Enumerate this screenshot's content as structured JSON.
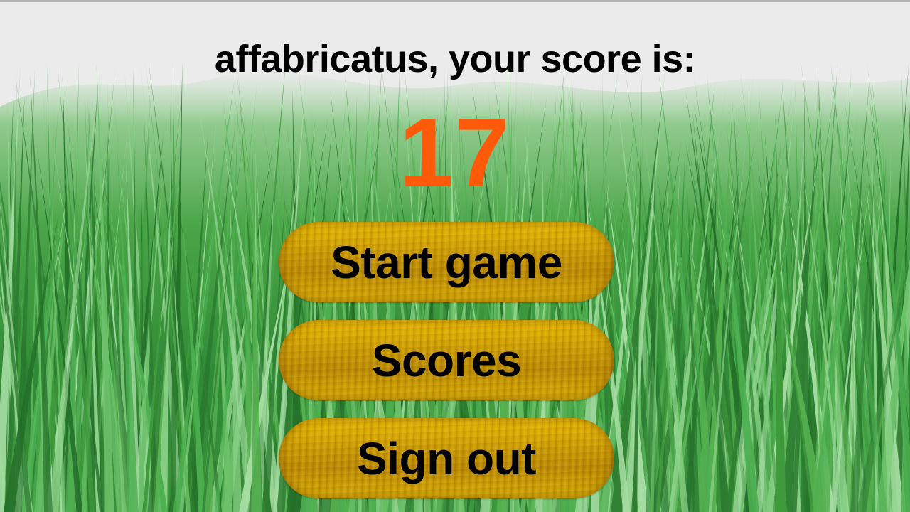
{
  "screen": {
    "player_name": "affabricatus",
    "headline": "affabricatus, your score is:",
    "score": "17",
    "background": "grass-field-image"
  },
  "menu": {
    "start_label": "Start game",
    "scores_label": "Scores",
    "signout_label": "Sign out"
  },
  "colors": {
    "score": "#ff5a0a",
    "button_gold": "#c69500",
    "sky": "#ebebeb",
    "grass": "#3f9a3c"
  }
}
